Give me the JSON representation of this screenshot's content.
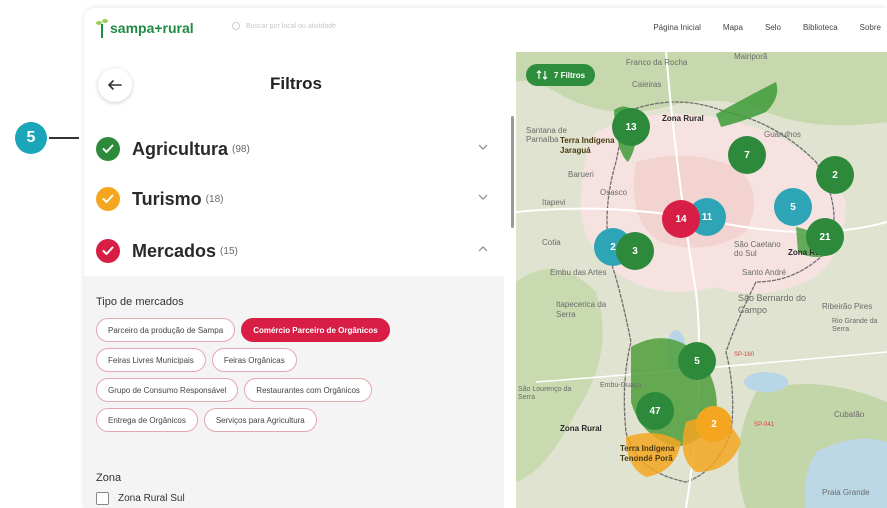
{
  "annotation": {
    "number": "5"
  },
  "header": {
    "logo_text": "sampa+rural",
    "search_placeholder": "Buscar por local ou atividade",
    "nav": [
      "Página Inicial",
      "Mapa",
      "Selo",
      "Biblioteca",
      "Sobre"
    ]
  },
  "sidebar": {
    "title": "Filtros",
    "categories": [
      {
        "label": "Agricultura",
        "count": "(98)",
        "color": "#2d8a3a",
        "expanded": false
      },
      {
        "label": "Turismo",
        "count": "(18)",
        "color": "#f4a621",
        "expanded": false
      },
      {
        "label": "Mercados",
        "count": "(15)",
        "color": "#d91e46",
        "expanded": true
      }
    ],
    "market_type_title": "Tipo de mercados",
    "market_types": [
      [
        "Parceiro da produção de Sampa",
        "Comércio Parceiro de Orgânicos"
      ],
      [
        "Feiras Livres Municipais",
        "Feiras Orgânicas"
      ],
      [
        "Grupo de Consumo Responsável",
        "Restaurantes com Orgânicos"
      ],
      [
        "Entrega de Orgânicos",
        "Serviços para Agricultura"
      ]
    ],
    "active_market_type": "Comércio Parceiro de Orgânicos",
    "zone_title": "Zona",
    "zone_item": "Zona Rural Sul"
  },
  "map": {
    "filter_pill": "7 Filtros",
    "place_labels": [
      "Franco da Rocha",
      "Mairiporã",
      "Caieiras",
      "Santana de Parnaíba",
      "Guarulhos",
      "Barueri",
      "Osasco",
      "Itapevi",
      "Cotia",
      "Embu das Artes",
      "São Caetano do Sul",
      "Santo André",
      "São Bernardo do Campo",
      "Itapecerica da Serra",
      "Ribeirão Pires",
      "Rio Grande da Serra",
      "Embu-Guaçu",
      "São Lourenço da Serra",
      "Cubatão",
      "Praia Grande",
      "SP-160",
      "SP-041"
    ],
    "area_labels": [
      "Zona Rural",
      "Terra Indígena Jaraguá",
      "Zona Rural",
      "Zona Rural",
      "Terra Indígena Tenondé Porã"
    ],
    "clusters": [
      {
        "count": "13",
        "color": "#2d8a3a"
      },
      {
        "count": "7",
        "color": "#2d8a3a"
      },
      {
        "count": "2",
        "color": "#2d8a3a"
      },
      {
        "count": "5",
        "color": "#2ea4b7"
      },
      {
        "count": "11",
        "color": "#2ea4b7"
      },
      {
        "count": "14",
        "color": "#d91e46"
      },
      {
        "count": "21",
        "color": "#2d8a3a"
      },
      {
        "count": "2",
        "color": "#2ea4b7"
      },
      {
        "count": "3",
        "color": "#2d8a3a"
      },
      {
        "count": "5",
        "color": "#2d8a3a"
      },
      {
        "count": "47",
        "color": "#2d8a3a"
      },
      {
        "count": "2",
        "color": "#f4a621"
      }
    ]
  }
}
